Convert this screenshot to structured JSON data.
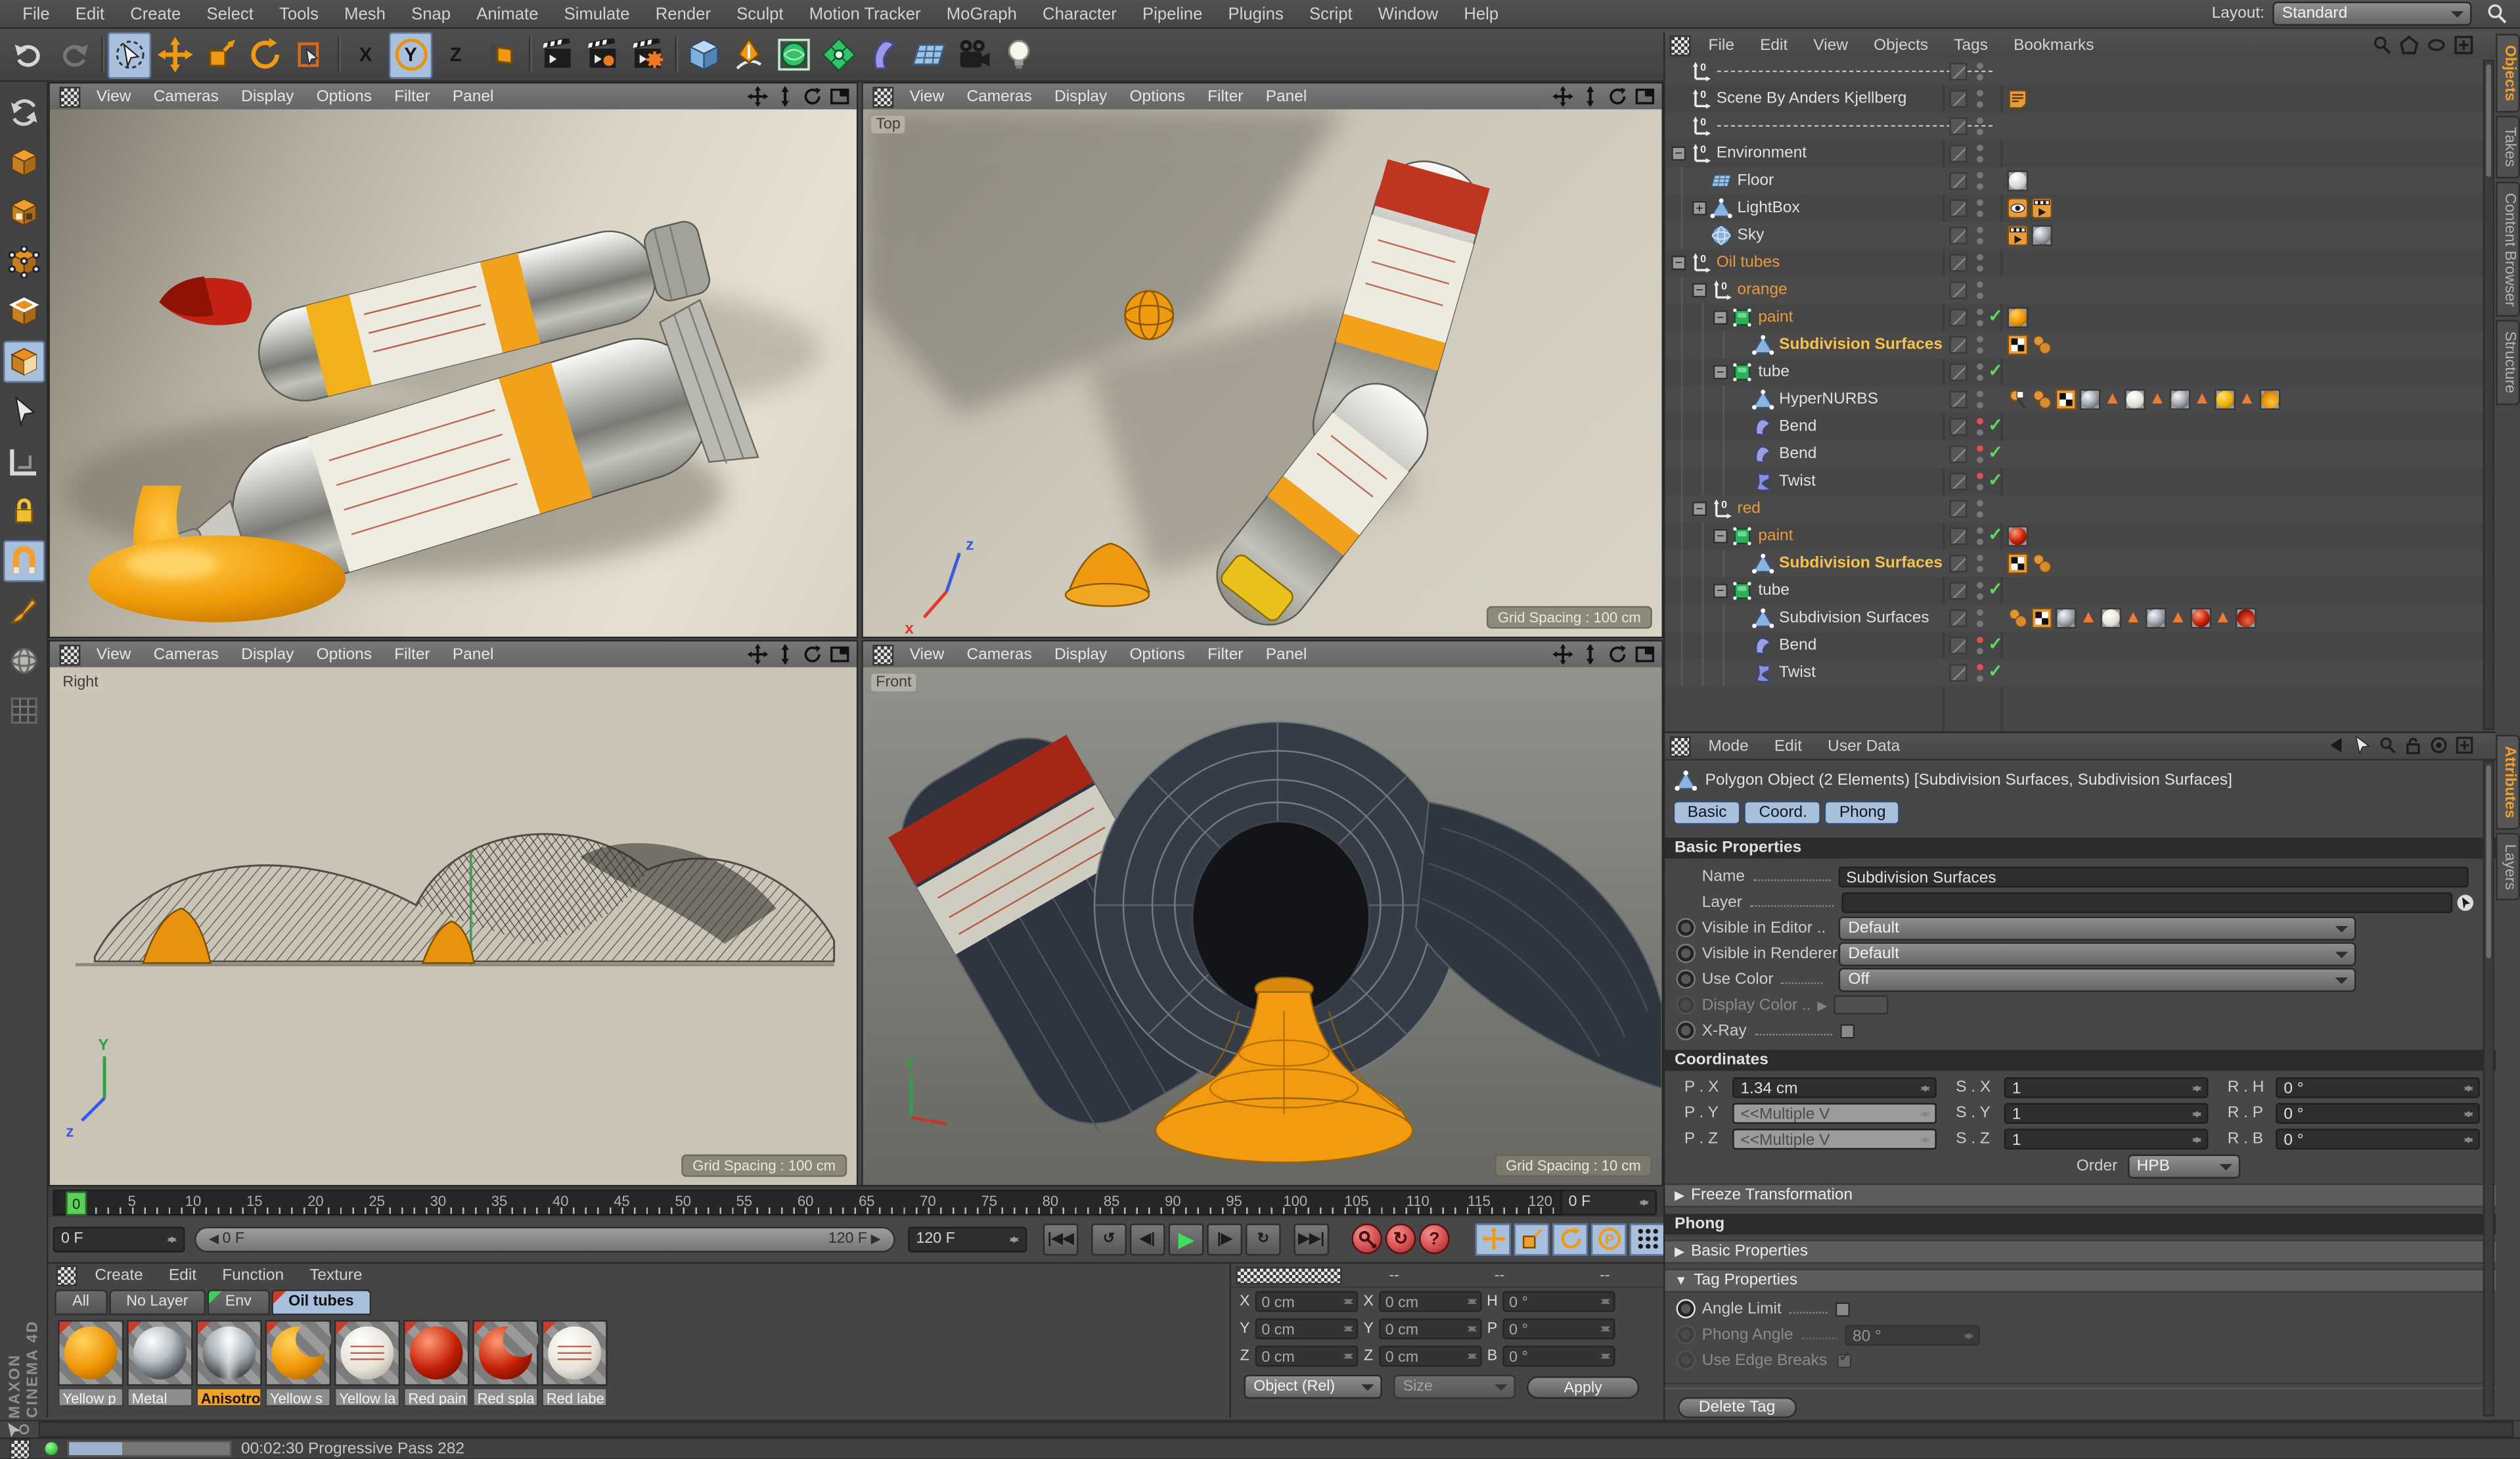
{
  "menubar": {
    "items": [
      "File",
      "Edit",
      "Create",
      "Select",
      "Tools",
      "Mesh",
      "Snap",
      "Animate",
      "Simulate",
      "Render",
      "Sculpt",
      "Motion Tracker",
      "MoGraph",
      "Character",
      "Pipeline",
      "Plugins",
      "Script",
      "Window",
      "Help"
    ]
  },
  "layout": {
    "label": "Layout:",
    "value": "Standard"
  },
  "toolbar": {
    "buttons": [
      {
        "id": "undo"
      },
      {
        "id": "redo"
      },
      {
        "id": "sep"
      },
      {
        "id": "live-selection",
        "hl": true
      },
      {
        "id": "move"
      },
      {
        "id": "scale"
      },
      {
        "id": "rotate"
      },
      {
        "id": "last-tool"
      },
      {
        "id": "sep"
      },
      {
        "id": "axis-x",
        "text": "X"
      },
      {
        "id": "axis-y",
        "text": "Y",
        "hl": true
      },
      {
        "id": "axis-z",
        "text": "Z"
      },
      {
        "id": "coordinate-system"
      },
      {
        "id": "sep"
      },
      {
        "id": "render-view"
      },
      {
        "id": "render-picture-viewer"
      },
      {
        "id": "render-settings"
      },
      {
        "id": "sep"
      },
      {
        "id": "add-cube"
      },
      {
        "id": "add-spline"
      },
      {
        "id": "add-subdivision"
      },
      {
        "id": "add-cloner"
      },
      {
        "id": "add-deformer"
      },
      {
        "id": "add-floor"
      },
      {
        "id": "add-camera"
      },
      {
        "id": "add-light"
      }
    ]
  },
  "left_palette": {
    "buttons": [
      {
        "id": "make-editable"
      },
      {
        "id": "model-mode"
      },
      {
        "id": "texture-mode"
      },
      {
        "id": "points-mode"
      },
      {
        "id": "edges-mode"
      },
      {
        "id": "polygons-mode",
        "hl": true
      },
      {
        "id": "tweak-mode"
      },
      {
        "id": "workplane-mode"
      },
      {
        "id": "axis-lock"
      },
      {
        "id": "snap-toggle",
        "hl": true
      },
      {
        "id": "brush-tool"
      },
      {
        "id": "viewport-solo"
      },
      {
        "id": "grid-toggle"
      }
    ]
  },
  "viewport_menu": [
    "View",
    "Cameras",
    "Display",
    "Options",
    "Filter",
    "Panel"
  ],
  "viewports": [
    {
      "label": "",
      "grid": ""
    },
    {
      "label": "Top",
      "grid": "Grid Spacing : 100 cm"
    },
    {
      "label": "Right",
      "grid": "Grid Spacing : 100 cm"
    },
    {
      "label": "Front",
      "grid": "Grid Spacing : 10 cm"
    }
  ],
  "timeline": {
    "min": 0,
    "max": 120,
    "label_step": 5,
    "marker_label": "0",
    "right_field": "0 F",
    "current_field": "0 F",
    "range_start": "0 F",
    "range_end": "120 F",
    "end_field": "120 F"
  },
  "transport": {
    "buttons": [
      {
        "id": "goto-start"
      },
      {
        "id": "play-backward"
      },
      {
        "id": "prev-frame"
      },
      {
        "id": "play"
      },
      {
        "id": "next-frame"
      },
      {
        "id": "play-forward"
      },
      {
        "id": "goto-end"
      },
      {
        "id": "record-keyframe"
      },
      {
        "id": "autokey"
      },
      {
        "id": "keying-help"
      },
      {
        "id": "key-position"
      },
      {
        "id": "key-scale"
      },
      {
        "id": "key-rotation"
      },
      {
        "id": "key-parameter"
      },
      {
        "id": "key-pla"
      },
      {
        "id": "timeline-window"
      }
    ]
  },
  "object_manager": {
    "menu": [
      "File",
      "Edit",
      "View",
      "Objects",
      "Tags",
      "Bookmarks"
    ],
    "side_tabs": [
      {
        "label": "Objects",
        "active": true
      },
      {
        "label": "Takes",
        "active": false
      },
      {
        "label": "Content Browser",
        "active": false
      },
      {
        "label": "Structure",
        "active": false
      }
    ],
    "rows": [
      {
        "name": "----------------------------------------",
        "icon": "null",
        "indent": 0,
        "expand": null,
        "color": "white",
        "reddot": false,
        "check": false,
        "tags": []
      },
      {
        "name": "Scene By Anders Kjellberg",
        "icon": "null",
        "indent": 0,
        "expand": null,
        "color": "white",
        "reddot": false,
        "check": false,
        "tags": [
          "note"
        ]
      },
      {
        "name": "----------------------------------------",
        "icon": "null",
        "indent": 0,
        "expand": null,
        "color": "white",
        "reddot": false,
        "check": false,
        "tags": []
      },
      {
        "name": "Environment",
        "icon": "null",
        "indent": 0,
        "expand": "minus",
        "color": "white",
        "reddot": false,
        "check": false,
        "tags": []
      },
      {
        "name": "Floor",
        "icon": "floor",
        "indent": 1,
        "expand": null,
        "color": "white",
        "reddot": false,
        "check": false,
        "tags": [
          "mat-white"
        ]
      },
      {
        "name": "LightBox",
        "icon": "tri",
        "indent": 1,
        "expand": "plus",
        "color": "white",
        "reddot": false,
        "check": false,
        "tags": [
          "eye",
          "render"
        ]
      },
      {
        "name": "Sky",
        "icon": "sky",
        "indent": 1,
        "expand": null,
        "color": "white",
        "reddot": false,
        "check": false,
        "tags": [
          "render",
          "mat-chrome"
        ]
      },
      {
        "name": "Oil tubes",
        "icon": "null",
        "indent": 0,
        "expand": "minus",
        "color": "orange",
        "reddot": false,
        "check": false,
        "tags": []
      },
      {
        "name": "orange",
        "icon": "null",
        "indent": 1,
        "expand": "minus",
        "color": "orange",
        "reddot": false,
        "check": false,
        "tags": []
      },
      {
        "name": "paint",
        "icon": "pcube",
        "indent": 2,
        "expand": "minus",
        "color": "orange",
        "reddot": false,
        "check": true,
        "tags": [
          "mat-orange"
        ]
      },
      {
        "name": "Subdivision Surfaces",
        "icon": "tri",
        "indent": 3,
        "expand": null,
        "color": "selected",
        "reddot": false,
        "check": false,
        "tags": [
          "checker",
          "uvw"
        ]
      },
      {
        "name": "tube",
        "icon": "pcube",
        "indent": 2,
        "expand": "minus",
        "color": "white",
        "reddot": false,
        "check": true,
        "tags": []
      },
      {
        "name": "HyperNURBS",
        "icon": "tri",
        "indent": 3,
        "expand": null,
        "color": "white",
        "reddot": false,
        "check": false,
        "tags": [
          "pin",
          "uvw",
          "checker",
          "mat-chrome",
          "seltri",
          "mat-label",
          "seltri",
          "mat-chrome",
          "seltri",
          "mat-yellow",
          "seltri",
          "mat-ysplash"
        ]
      },
      {
        "name": "Bend",
        "icon": "bend",
        "indent": 3,
        "expand": null,
        "color": "white",
        "reddot": true,
        "check": true,
        "tags": []
      },
      {
        "name": "Bend",
        "icon": "bend",
        "indent": 3,
        "expand": null,
        "color": "white",
        "reddot": true,
        "check": true,
        "tags": []
      },
      {
        "name": "Twist",
        "icon": "twist",
        "indent": 3,
        "expand": null,
        "color": "white",
        "reddot": true,
        "check": true,
        "tags": []
      },
      {
        "name": "red",
        "icon": "null",
        "indent": 1,
        "expand": "minus",
        "color": "orange",
        "reddot": false,
        "check": false,
        "tags": []
      },
      {
        "name": "paint",
        "icon": "pcube",
        "indent": 2,
        "expand": "minus",
        "color": "orange",
        "reddot": false,
        "check": true,
        "tags": [
          "mat-red"
        ]
      },
      {
        "name": "Subdivision Surfaces",
        "icon": "tri",
        "indent": 3,
        "expand": null,
        "color": "selected",
        "reddot": false,
        "check": false,
        "tags": [
          "checker",
          "uvw"
        ]
      },
      {
        "name": "tube",
        "icon": "pcube",
        "indent": 2,
        "expand": "minus",
        "color": "white",
        "reddot": false,
        "check": true,
        "tags": []
      },
      {
        "name": "Subdivision Surfaces",
        "icon": "tri",
        "indent": 3,
        "expand": null,
        "color": "white",
        "reddot": false,
        "check": false,
        "tags": [
          "uvw",
          "checker",
          "mat-chrome",
          "seltri",
          "mat-label",
          "seltri",
          "mat-chrome",
          "seltri",
          "mat-red",
          "seltri",
          "mat-rsplash"
        ]
      },
      {
        "name": "Bend",
        "icon": "bend",
        "indent": 3,
        "expand": null,
        "color": "white",
        "reddot": true,
        "check": true,
        "tags": []
      },
      {
        "name": "Twist",
        "icon": "twist",
        "indent": 3,
        "expand": null,
        "color": "white",
        "reddot": true,
        "check": true,
        "tags": []
      }
    ]
  },
  "attributes": {
    "menu": [
      "Mode",
      "Edit",
      "User Data"
    ],
    "object_title": "Polygon Object (2 Elements) [Subdivision Surfaces, Subdivision Surfaces]",
    "tabs": [
      "Basic",
      "Coord.",
      "Phong"
    ],
    "basic": {
      "header": "Basic Properties",
      "name_label": "Name",
      "name_value": "Subdivision Surfaces",
      "layer_label": "Layer",
      "visible_editor_label": "Visible in Editor ..",
      "visible_editor_value": "Default",
      "visible_renderer_label": "Visible in Renderer",
      "visible_renderer_value": "Default",
      "use_color_label": "Use Color",
      "use_color_value": "Off",
      "display_color_label": "Display Color ..",
      "xray_label": "X-Ray"
    },
    "coordinates": {
      "header": "Coordinates",
      "fields": [
        {
          "label": "P . X",
          "value": "1.34 cm",
          "multi": false
        },
        {
          "label": "S . X",
          "value": "1",
          "multi": false
        },
        {
          "label": "R . H",
          "value": "0 °",
          "multi": false
        },
        {
          "label": "P . Y",
          "value": "<<Multiple V",
          "multi": true
        },
        {
          "label": "S . Y",
          "value": "1",
          "multi": false
        },
        {
          "label": "R . P",
          "value": "0 °",
          "multi": false
        },
        {
          "label": "P . Z",
          "value": "<<Multiple V",
          "multi": true
        },
        {
          "label": "S . Z",
          "value": "1",
          "multi": false
        },
        {
          "label": "R . B",
          "value": "0 °",
          "multi": false
        }
      ],
      "order_label": "Order",
      "order_value": "HPB",
      "freeze_label": "Freeze Transformation"
    },
    "phong": {
      "header": "Phong",
      "basic_props_label": "Basic Properties",
      "tag_props_label": "Tag Properties",
      "angle_limit_label": "Angle Limit",
      "phong_angle_label": "Phong Angle",
      "phong_angle_value": "80 °",
      "edge_breaks_label": "Use Edge Breaks",
      "delete_tag_label": "Delete Tag"
    },
    "side_tabs": [
      {
        "label": "Attributes",
        "active": true
      },
      {
        "label": "Layers",
        "active": false
      }
    ]
  },
  "materials": {
    "menu": [
      "Create",
      "Edit",
      "Function",
      "Texture"
    ],
    "tabs": [
      {
        "label": "All",
        "corner": null,
        "active": false
      },
      {
        "label": "No Layer",
        "corner": null,
        "active": false
      },
      {
        "label": "Env",
        "corner": "green",
        "active": false
      },
      {
        "label": "Oil tubes",
        "corner": "red",
        "active": true
      }
    ],
    "items": [
      {
        "name": "Yellow p",
        "kind": "orange",
        "selected": false
      },
      {
        "name": "Metal",
        "kind": "chrome",
        "selected": false
      },
      {
        "name": "Anisotro",
        "kind": "aniso",
        "selected": true
      },
      {
        "name": "Yellow s",
        "kind": "orange-splash",
        "selected": false
      },
      {
        "name": "Yellow la",
        "kind": "label",
        "selected": false
      },
      {
        "name": "Red pain",
        "kind": "red",
        "selected": false
      },
      {
        "name": "Red spla",
        "kind": "red-splash",
        "selected": false
      },
      {
        "name": "Red labe",
        "kind": "label",
        "selected": false
      }
    ]
  },
  "coord_panel": {
    "headers": [
      "--",
      "--",
      "--"
    ],
    "rows": [
      [
        {
          "label": "X",
          "value": "0 cm"
        },
        {
          "label": "X",
          "value": "0 cm"
        },
        {
          "label": "H",
          "value": "0 °"
        }
      ],
      [
        {
          "label": "Y",
          "value": "0 cm"
        },
        {
          "label": "Y",
          "value": "0 cm"
        },
        {
          "label": "P",
          "value": "0 °"
        }
      ],
      [
        {
          "label": "Z",
          "value": "0 cm"
        },
        {
          "label": "Z",
          "value": "0 cm"
        },
        {
          "label": "B",
          "value": "0 °"
        }
      ]
    ],
    "mode_value": "Object (Rel)",
    "size_value": "Size",
    "apply_label": "Apply"
  },
  "status": {
    "time": "00:02:30 Progressive Pass 282"
  },
  "branding": {
    "line1": "MAXON",
    "line2": "CINEMA 4D"
  },
  "colors": {
    "accent_orange": "#f0a030",
    "selection_blue": "#a9c0dd",
    "check_green": "#5fd65f",
    "marker_green": "#5ad05a"
  }
}
